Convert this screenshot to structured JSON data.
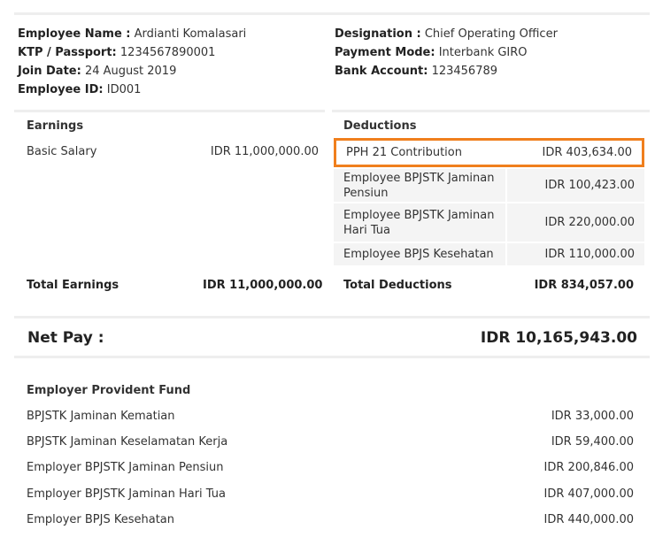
{
  "employee": {
    "name_label": "Employee Name :",
    "name": "Ardianti Komalasari",
    "ktp_label": "KTP / Passport:",
    "ktp": "1234567890001",
    "join_label": "Join Date:",
    "join": "24 August 2019",
    "id_label": "Employee ID:",
    "id": "ID001",
    "designation_label": "Designation :",
    "designation": "Chief Operating Officer",
    "payment_label": "Payment Mode:",
    "payment": "Interbank GIRO",
    "bank_label": "Bank Account:",
    "bank": "123456789"
  },
  "earnings": {
    "title": "Earnings",
    "items": [
      {
        "label": "Basic Salary",
        "amount": "IDR 11,000,000.00"
      }
    ],
    "total_label": "Total Earnings",
    "total": "IDR 11,000,000.00"
  },
  "deductions": {
    "title": "Deductions",
    "items": [
      {
        "label": "PPH 21 Contribution",
        "amount": "IDR 403,634.00"
      },
      {
        "label": "Employee BPJSTK Jaminan Pensiun",
        "amount": "IDR 100,423.00"
      },
      {
        "label": "Employee BPJSTK Jaminan Hari Tua",
        "amount": "IDR 220,000.00"
      },
      {
        "label": "Employee BPJS Kesehatan",
        "amount": "IDR 110,000.00"
      }
    ],
    "total_label": "Total Deductions",
    "total": "IDR 834,057.00",
    "highlight_color": "#f07f1d"
  },
  "netpay": {
    "label": "Net Pay :",
    "value": "IDR 10,165,943.00"
  },
  "provident_fund": {
    "title": "Employer Provident Fund",
    "items": [
      {
        "label": "BPJSTK Jaminan Kematian",
        "amount": "IDR 33,000.00"
      },
      {
        "label": "BPJSTK Jaminan Keselamatan Kerja",
        "amount": "IDR 59,400.00"
      },
      {
        "label": "Employer BPJSTK Jaminan Pensiun",
        "amount": "IDR 200,846.00"
      },
      {
        "label": "Employer BPJSTK Jaminan Hari Tua",
        "amount": "IDR 407,000.00"
      },
      {
        "label": "Employer BPJS Kesehatan",
        "amount": "IDR 440,000.00"
      }
    ]
  }
}
